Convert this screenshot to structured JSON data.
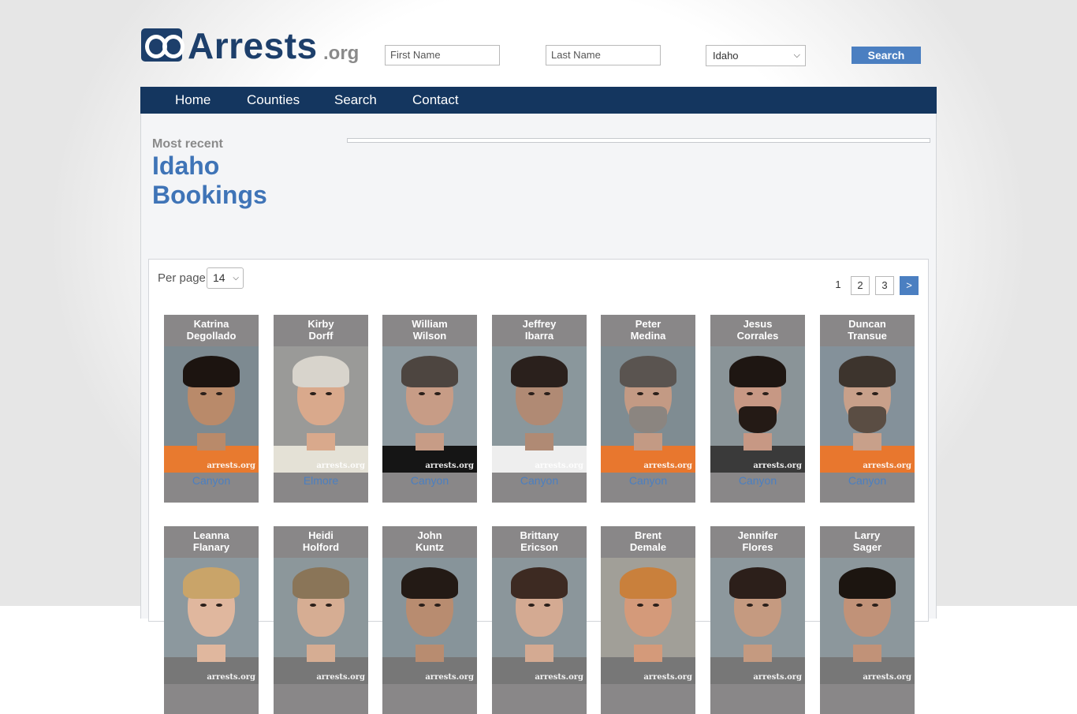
{
  "header": {
    "logo_text": "Arrests",
    "logo_suffix": ".org",
    "first_name_placeholder": "First Name",
    "last_name_placeholder": "Last Name",
    "state_selected": "Idaho",
    "search_label": "Search"
  },
  "nav": [
    {
      "label": "Home"
    },
    {
      "label": "Counties"
    },
    {
      "label": "Search"
    },
    {
      "label": "Contact"
    }
  ],
  "hero": {
    "kicker": "Most recent",
    "title": "Idaho Bookings"
  },
  "listing": {
    "per_page_label": "Per page",
    "per_page_value": "14",
    "pagination": [
      "1",
      "2",
      "3",
      ">"
    ]
  },
  "watermark": "arrests.org",
  "colors": {
    "nav_bg": "#14365f",
    "accent": "#4b7fc1",
    "card_bg": "#898788"
  },
  "bookings": [
    {
      "first": "Katrina",
      "last": "Degollado",
      "county": "Canyon"
    },
    {
      "first": "Kirby",
      "last": "Dorff",
      "county": "Elmore"
    },
    {
      "first": "William",
      "last": "Wilson",
      "county": "Canyon"
    },
    {
      "first": "Jeffrey",
      "last": "Ibarra",
      "county": "Canyon"
    },
    {
      "first": "Peter",
      "last": "Medina",
      "county": "Canyon"
    },
    {
      "first": "Jesus",
      "last": "Corrales",
      "county": "Canyon"
    },
    {
      "first": "Duncan",
      "last": "Transue",
      "county": "Canyon"
    },
    {
      "first": "Leanna",
      "last": "Flanary",
      "county": ""
    },
    {
      "first": "Heidi",
      "last": "Holford",
      "county": ""
    },
    {
      "first": "John",
      "last": "Kuntz",
      "county": ""
    },
    {
      "first": "Brittany",
      "last": "Ericson",
      "county": ""
    },
    {
      "first": "Brent",
      "last": "Demale",
      "county": ""
    },
    {
      "first": "Jennifer",
      "last": "Flores",
      "county": ""
    },
    {
      "first": "Larry",
      "last": "Sager",
      "county": ""
    }
  ]
}
